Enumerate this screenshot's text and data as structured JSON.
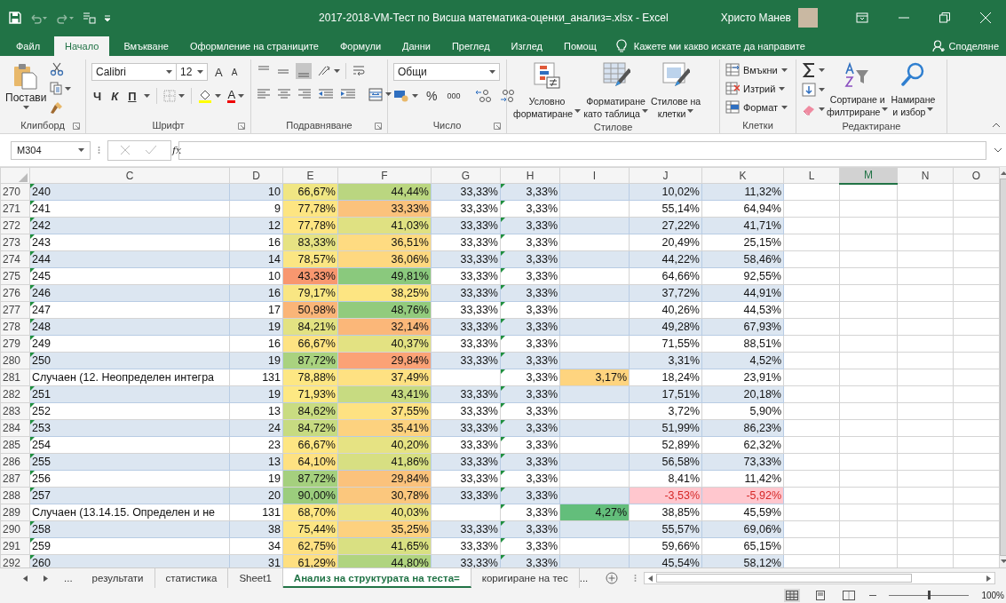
{
  "title_bar": {
    "title": "2017-2018-VM-Тест по Висша математика-оценки_анализ=.xlsx  -  Excel",
    "user": "Христо Манев"
  },
  "menu_tabs": [
    {
      "label": "Файл",
      "selected": false
    },
    {
      "label": "Начало",
      "selected": true
    },
    {
      "label": "Вмъкване",
      "selected": false
    },
    {
      "label": "Оформление на страниците",
      "selected": false
    },
    {
      "label": "Формули",
      "selected": false
    },
    {
      "label": "Данни",
      "selected": false
    },
    {
      "label": "Преглед",
      "selected": false
    },
    {
      "label": "Изглед",
      "selected": false
    },
    {
      "label": "Помощ",
      "selected": false
    }
  ],
  "tell_me": "Кажете ми какво искате да направите",
  "share": "Споделяне",
  "ribbon": {
    "clipboard": {
      "paste": "Постави",
      "label": "Клипборд"
    },
    "font": {
      "name": "Calibri",
      "size": "12",
      "grow": "A",
      "shrink": "A",
      "bold": "Ч",
      "italic": "К",
      "underline": "П",
      "font_color": "A",
      "label": "Шрифт"
    },
    "alignment": {
      "label": "Подравняване"
    },
    "number": {
      "format": "Общи",
      "percent": "%",
      "thousands": "000",
      "label": "Число"
    },
    "styles": {
      "buttons": [
        {
          "lines": [
            "Условно",
            "форматиране"
          ]
        },
        {
          "lines": [
            "Форматиране",
            "като таблица"
          ]
        },
        {
          "lines": [
            "Стилове на",
            "клетки"
          ]
        }
      ],
      "label": "Стилове"
    },
    "cells": {
      "buttons": [
        "Вмъкни",
        "Изтрий",
        "Формат"
      ],
      "label": "Клетки"
    },
    "editing": {
      "buttons": [
        {
          "lines": [
            "Сортиране и",
            "филтриране"
          ]
        },
        {
          "lines": [
            "Намиране",
            "и избор"
          ]
        }
      ],
      "label": "Редактиране"
    }
  },
  "formula_bar": {
    "name_box": "M304",
    "fx": "fx"
  },
  "columns": [
    {
      "label": "C",
      "selected": false
    },
    {
      "label": "D",
      "selected": false
    },
    {
      "label": "E",
      "selected": false
    },
    {
      "label": "F",
      "selected": false
    },
    {
      "label": "G",
      "selected": false
    },
    {
      "label": "H",
      "selected": false
    },
    {
      "label": "I",
      "selected": false
    },
    {
      "label": "J",
      "selected": false
    },
    {
      "label": "K",
      "selected": false
    },
    {
      "label": "L",
      "selected": false
    },
    {
      "label": "M",
      "selected": true
    },
    {
      "label": "N",
      "selected": false
    },
    {
      "label": "O",
      "selected": false
    }
  ],
  "rows": [
    {
      "number": "270",
      "banded": true,
      "cells": [
        {
          "text": "240",
          "flag": true
        },
        {
          "text": "10"
        },
        {
          "text": "66,67%",
          "color": "#f0e683"
        },
        {
          "text": "44,44%",
          "color": "#bad680"
        },
        {
          "text": "33,33%"
        },
        {
          "text": "3,33%",
          "flag": true
        },
        {},
        {
          "text": "10,02%"
        },
        {
          "text": "11,32%"
        }
      ]
    },
    {
      "number": "271",
      "banded": false,
      "cells": [
        {
          "text": "241",
          "flag": true
        },
        {
          "text": "9"
        },
        {
          "text": "77,78%",
          "color": "#fde582"
        },
        {
          "text": "33,33%",
          "color": "#fbc27c"
        },
        {
          "text": "33,33%"
        },
        {
          "text": "3,33%",
          "flag": true
        },
        {},
        {
          "text": "55,14%"
        },
        {
          "text": "64,94%"
        }
      ]
    },
    {
      "number": "272",
      "banded": true,
      "cells": [
        {
          "text": "242",
          "flag": true
        },
        {
          "text": "12"
        },
        {
          "text": "77,78%",
          "color": "#fde582"
        },
        {
          "text": "41,03%",
          "color": "#dfe182"
        },
        {
          "text": "33,33%"
        },
        {
          "text": "3,33%",
          "flag": true
        },
        {},
        {
          "text": "27,22%"
        },
        {
          "text": "41,71%"
        }
      ]
    },
    {
      "number": "273",
      "banded": false,
      "cells": [
        {
          "text": "243",
          "flag": true
        },
        {
          "text": "16"
        },
        {
          "text": "83,33%",
          "color": "#e6e383"
        },
        {
          "text": "36,51%",
          "color": "#fedb81"
        },
        {
          "text": "33,33%"
        },
        {
          "text": "3,33%",
          "flag": true
        },
        {},
        {
          "text": "20,49%"
        },
        {
          "text": "25,15%"
        }
      ]
    },
    {
      "number": "274",
      "banded": true,
      "cells": [
        {
          "text": "244",
          "flag": true
        },
        {
          "text": "14"
        },
        {
          "text": "78,57%",
          "color": "#fbe683"
        },
        {
          "text": "36,06%",
          "color": "#fed880"
        },
        {
          "text": "33,33%"
        },
        {
          "text": "3,33%",
          "flag": true
        },
        {},
        {
          "text": "44,22%"
        },
        {
          "text": "58,46%"
        }
      ]
    },
    {
      "number": "275",
      "banded": false,
      "cells": [
        {
          "text": "245",
          "flag": true
        },
        {
          "text": "10"
        },
        {
          "text": "43,33%",
          "color": "#f8976f"
        },
        {
          "text": "49,81%",
          "color": "#8ac97d"
        },
        {
          "text": "33,33%"
        },
        {
          "text": "3,33%",
          "flag": true
        },
        {},
        {
          "text": "64,66%"
        },
        {
          "text": "92,55%"
        }
      ]
    },
    {
      "number": "276",
      "banded": true,
      "cells": [
        {
          "text": "246",
          "flag": true
        },
        {
          "text": "16"
        },
        {
          "text": "79,17%",
          "color": "#f9e683"
        },
        {
          "text": "38,25%",
          "color": "#fde582"
        },
        {
          "text": "33,33%"
        },
        {
          "text": "3,33%",
          "flag": true
        },
        {},
        {
          "text": "37,72%"
        },
        {
          "text": "44,91%"
        }
      ]
    },
    {
      "number": "277",
      "banded": false,
      "cells": [
        {
          "text": "247",
          "flag": true
        },
        {
          "text": "17"
        },
        {
          "text": "50,98%",
          "color": "#fab578"
        },
        {
          "text": "48,76%",
          "color": "#92cb7d"
        },
        {
          "text": "33,33%"
        },
        {
          "text": "3,33%",
          "flag": true
        },
        {},
        {
          "text": "40,26%"
        },
        {
          "text": "44,53%"
        }
      ]
    },
    {
      "number": "278",
      "banded": true,
      "cells": [
        {
          "text": "248",
          "flag": true
        },
        {
          "text": "19"
        },
        {
          "text": "84,21%",
          "color": "#e2e282"
        },
        {
          "text": "32,14%",
          "color": "#fbb779"
        },
        {
          "text": "33,33%"
        },
        {
          "text": "3,33%",
          "flag": true
        },
        {},
        {
          "text": "49,28%"
        },
        {
          "text": "67,93%"
        }
      ]
    },
    {
      "number": "279",
      "banded": false,
      "cells": [
        {
          "text": "249",
          "flag": true
        },
        {
          "text": "16"
        },
        {
          "text": "66,67%",
          "color": "#fee382"
        },
        {
          "text": "40,37%",
          "color": "#e3e282"
        },
        {
          "text": "33,33%"
        },
        {
          "text": "3,33%",
          "flag": true
        },
        {},
        {
          "text": "71,55%"
        },
        {
          "text": "88,51%"
        }
      ]
    },
    {
      "number": "280",
      "banded": true,
      "cells": [
        {
          "text": "250",
          "flag": true
        },
        {
          "text": "19"
        },
        {
          "text": "87,72%",
          "color": "#a9d27f"
        },
        {
          "text": "29,84%",
          "color": "#fba276"
        },
        {
          "text": "33,33%"
        },
        {
          "text": "3,33%",
          "flag": true
        },
        {},
        {
          "text": "3,31%"
        },
        {
          "text": "4,52%"
        }
      ]
    },
    {
      "number": "281",
      "banded": false,
      "cells": [
        {
          "text": "Случаен (12. Неопределен интегра",
          "flag": false
        },
        {
          "text": "131"
        },
        {
          "text": "78,88%",
          "color": "#fde783"
        },
        {
          "text": "37,49%",
          "color": "#fee182"
        },
        {},
        {
          "text": "3,33%",
          "flag": true
        },
        {
          "text": "3,17%",
          "color": "#fed47f"
        },
        {
          "text": "18,24%"
        },
        {
          "text": "23,91%"
        }
      ]
    },
    {
      "number": "282",
      "banded": true,
      "cells": [
        {
          "text": "251",
          "flag": true
        },
        {
          "text": "19"
        },
        {
          "text": "71,93%",
          "color": "#fde883"
        },
        {
          "text": "43,41%",
          "color": "#c7db81"
        },
        {
          "text": "33,33%"
        },
        {
          "text": "3,33%",
          "flag": true
        },
        {},
        {
          "text": "17,51%"
        },
        {
          "text": "20,18%"
        }
      ]
    },
    {
      "number": "283",
      "banded": false,
      "cells": [
        {
          "text": "252",
          "flag": true
        },
        {
          "text": "13"
        },
        {
          "text": "84,62%",
          "color": "#c9dc81"
        },
        {
          "text": "37,55%",
          "color": "#fee282"
        },
        {
          "text": "33,33%"
        },
        {
          "text": "3,33%",
          "flag": true
        },
        {},
        {
          "text": "3,72%"
        },
        {
          "text": "5,90%"
        }
      ]
    },
    {
      "number": "284",
      "banded": true,
      "cells": [
        {
          "text": "253",
          "flag": true
        },
        {
          "text": "24"
        },
        {
          "text": "84,72%",
          "color": "#c7db81"
        },
        {
          "text": "35,41%",
          "color": "#fdd27f"
        },
        {
          "text": "33,33%"
        },
        {
          "text": "3,33%",
          "flag": true
        },
        {},
        {
          "text": "51,99%"
        },
        {
          "text": "86,23%"
        }
      ]
    },
    {
      "number": "285",
      "banded": false,
      "cells": [
        {
          "text": "254",
          "flag": true
        },
        {
          "text": "23"
        },
        {
          "text": "66,67%",
          "color": "#fee683"
        },
        {
          "text": "40,20%",
          "color": "#e6e383"
        },
        {
          "text": "33,33%"
        },
        {
          "text": "3,33%",
          "flag": true
        },
        {},
        {
          "text": "52,89%"
        },
        {
          "text": "62,32%"
        }
      ]
    },
    {
      "number": "286",
      "banded": true,
      "cells": [
        {
          "text": "255",
          "flag": true
        },
        {
          "text": "13"
        },
        {
          "text": "64,10%",
          "color": "#fee182"
        },
        {
          "text": "41,86%",
          "color": "#d7df82"
        },
        {
          "text": "33,33%"
        },
        {
          "text": "3,33%",
          "flag": true
        },
        {},
        {
          "text": "56,58%"
        },
        {
          "text": "73,33%"
        }
      ]
    },
    {
      "number": "287",
      "banded": false,
      "cells": [
        {
          "text": "256",
          "flag": true
        },
        {
          "text": "19"
        },
        {
          "text": "87,72%",
          "color": "#a5d07e"
        },
        {
          "text": "29,84%",
          "color": "#fbc27c"
        },
        {
          "text": "33,33%"
        },
        {
          "text": "3,33%",
          "flag": true
        },
        {},
        {
          "text": "8,41%"
        },
        {
          "text": "11,42%"
        }
      ]
    },
    {
      "number": "288",
      "banded": true,
      "cells": [
        {
          "text": "257",
          "flag": true
        },
        {
          "text": "20"
        },
        {
          "text": "90,00%",
          "color": "#9bcd7d"
        },
        {
          "text": "30,78%",
          "color": "#fbc77d"
        },
        {
          "text": "33,33%"
        },
        {
          "text": "3,33%",
          "flag": true
        },
        {},
        {
          "text": "-3,53%",
          "negative": true,
          "color": "#ffc7ce"
        },
        {
          "text": "-5,92%",
          "negative": true,
          "color": "#ffc7ce"
        }
      ]
    },
    {
      "number": "289",
      "banded": false,
      "cells": [
        {
          "text": "Случаен (13.14.15. Определен и не",
          "flag": false
        },
        {
          "text": "131"
        },
        {
          "text": "68,70%",
          "color": "#fee683"
        },
        {
          "text": "40,03%",
          "color": "#ebe483"
        },
        {},
        {
          "text": "3,33%",
          "flag": true
        },
        {
          "text": "4,27%",
          "color": "#63be7b"
        },
        {
          "text": "38,85%"
        },
        {
          "text": "45,59%"
        }
      ]
    },
    {
      "number": "290",
      "banded": true,
      "cells": [
        {
          "text": "258",
          "flag": true
        },
        {
          "text": "38"
        },
        {
          "text": "75,44%",
          "color": "#fde583"
        },
        {
          "text": "35,25%",
          "color": "#fdd17f"
        },
        {
          "text": "33,33%"
        },
        {
          "text": "3,33%",
          "flag": true
        },
        {},
        {
          "text": "55,57%"
        },
        {
          "text": "69,06%"
        }
      ]
    },
    {
      "number": "291",
      "banded": false,
      "cells": [
        {
          "text": "259",
          "flag": true
        },
        {
          "text": "34"
        },
        {
          "text": "62,75%",
          "color": "#fee082"
        },
        {
          "text": "41,65%",
          "color": "#d9e082"
        },
        {
          "text": "33,33%"
        },
        {
          "text": "3,33%",
          "flag": true
        },
        {},
        {
          "text": "59,66%"
        },
        {
          "text": "65,15%"
        }
      ]
    },
    {
      "number": "292",
      "banded": true,
      "cells": [
        {
          "text": "260",
          "flag": true
        },
        {
          "text": "31"
        },
        {
          "text": "61,29%",
          "color": "#fedf81"
        },
        {
          "text": "44,80%",
          "color": "#b0d47f"
        },
        {
          "text": "33,33%"
        },
        {
          "text": "3,33%",
          "flag": true
        },
        {},
        {
          "text": "45,54%"
        },
        {
          "text": "58,12%"
        }
      ]
    }
  ],
  "sheet_tabs": {
    "more_before": "...",
    "tabs": [
      {
        "label": "результати",
        "selected": false
      },
      {
        "label": "статистика",
        "selected": false
      },
      {
        "label": "Sheet1",
        "selected": false
      },
      {
        "label": "Анализ на структурата на теста=",
        "selected": true
      },
      {
        "label": "коригиране на тес",
        "selected": false
      }
    ],
    "more_after": "..."
  },
  "status_bar": {
    "zoom_slider": {
      "level": 0.5
    },
    "zoom": "100%"
  }
}
